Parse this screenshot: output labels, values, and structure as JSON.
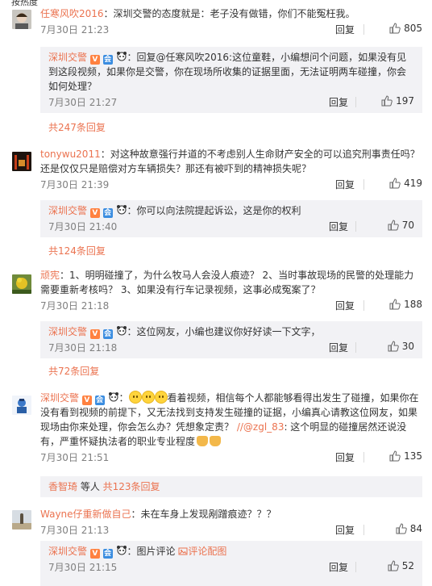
{
  "top_cut": "按热度",
  "comments": [
    {
      "user": "任寒风吹2016",
      "text": "：深圳交警的态度就是：老子没有做错，你们不能冤枉我。",
      "time": "7月30日 21:23",
      "reply_label": "回复",
      "likes": "805",
      "reply": {
        "user": "深圳交警",
        "text": "：回复@任寒风吹2016:这位童鞋，小编想问个问题，如果没有见到这段视频，如果你是交警，你在现场所收集的证据里面，无法证明两车碰撞，你会如何处理？",
        "time": "7月30日 21:27",
        "reply_label": "回复",
        "likes": "197"
      },
      "more": "共247条回复"
    },
    {
      "user": "tonywu2011",
      "text": "：对这种故意强行并道的不考虑别人生命财产安全的可以追究刑事责任吗？还是仅仅只是赔偿对方车辆损失？那还有被吓到的精神损失呢？",
      "time": "7月30日 21:39",
      "reply_label": "回复",
      "likes": "419",
      "reply": {
        "user": "深圳交警",
        "text": "：你可以向法院提起诉讼，这是你的权利",
        "time": "7月30日 21:40",
        "reply_label": "回复",
        "likes": "70"
      },
      "more": "共124条回复"
    },
    {
      "user": "顽宪",
      "text": "：1、明明碰撞了，为什么牧马人会没人痕迹？ 2、当时事故现场的民警的处理能力需要重新考核吗？ 3、如果没有行车记录视频，这事必成冤案了？",
      "time": "7月30日 21:18",
      "reply_label": "回复",
      "likes": "188",
      "reply": {
        "user": "深圳交警",
        "text": "：这位网友，小编也建议你好好读一下文字，",
        "time": "7月30日 21:18",
        "reply_label": "回复",
        "likes": "30"
      },
      "more": "共72条回复"
    },
    {
      "user": "深圳交警",
      "text_after_emoji": "看着视频，相信每个人都能够看得出发生了碰撞，如果你在没有看到视频的前提下，又无法找到支持发生碰撞的证据，小编真心请教这位网友，如果现场由你来处理，你会怎么办？凭想象定责？",
      "mention": "//@zgl_83",
      "text_tail": ": 这个明显的碰撞居然还说没有，严重怀疑执法者的职业专业程度",
      "time": "7月30日 21:51",
      "reply_label": "回复",
      "likes": "135",
      "more_user": "香智琦",
      "more_mid": " 等人 ",
      "more": "共123条回复"
    },
    {
      "user": "Wayne仔重新做自己",
      "text": "：未在车身上发现剐蹭痕迹？？？",
      "time": "7月30日 21:13",
      "reply_label": "回复",
      "likes": "84",
      "reply": {
        "user": "深圳交警",
        "text": "：",
        "pic_label": "图片评论",
        "pic_link": "评论配图",
        "time": "7月30日 21:15",
        "reply_label": "回复",
        "likes": "52"
      }
    }
  ],
  "colors": {
    "link": "#eb7350",
    "reply_bg": "#f2f2f5",
    "meta": "#808080"
  }
}
